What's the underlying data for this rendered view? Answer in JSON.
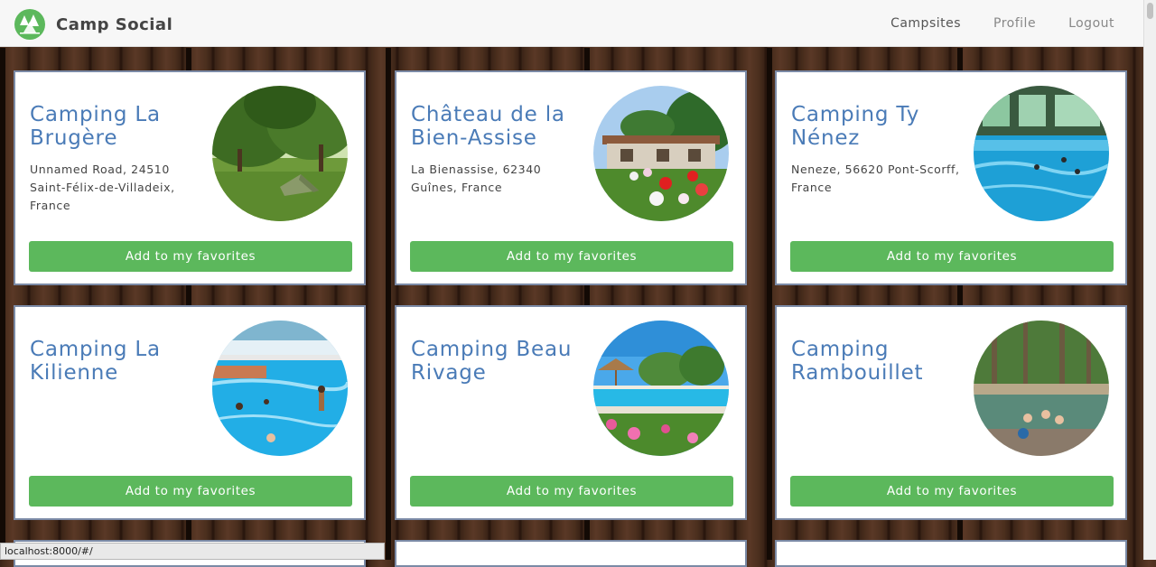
{
  "app": {
    "brand": "Camp Social",
    "brand_color": "#5cb85c"
  },
  "nav": {
    "items": [
      {
        "label": "Campsites",
        "active": true
      },
      {
        "label": "Profile",
        "active": false
      },
      {
        "label": "Logout",
        "active": false
      }
    ]
  },
  "campsites": [
    {
      "name": "Camping La Brugère",
      "address": "Unnamed Road, 24510 Saint-Félix-de-Villadeix, France",
      "button": "Add to my favorites",
      "image": "tent-in-meadow"
    },
    {
      "name": "Château de la Bien-Assise",
      "address": "La Bienassise, 62340 Guînes, France",
      "button": "Add to my favorites",
      "image": "building-with-flowers"
    },
    {
      "name": "Camping Ty Nénez",
      "address": "Neneze, 56620 Pont-Scorff, France",
      "button": "Add to my favorites",
      "image": "indoor-pool"
    },
    {
      "name": "Camping La Kilienne",
      "address": "",
      "button": "Add to my favorites",
      "image": "covered-pool"
    },
    {
      "name": "Camping Beau Rivage",
      "address": "",
      "button": "Add to my favorites",
      "image": "palm-pool"
    },
    {
      "name": "Camping Rambouillet",
      "address": "",
      "button": "Add to my favorites",
      "image": "natural-pool"
    }
  ],
  "status_bar": {
    "url": "localhost:8000/#/"
  },
  "colors": {
    "title": "#4a7bb7",
    "button": "#5cb85c",
    "card_border": "#7b8aa6"
  }
}
